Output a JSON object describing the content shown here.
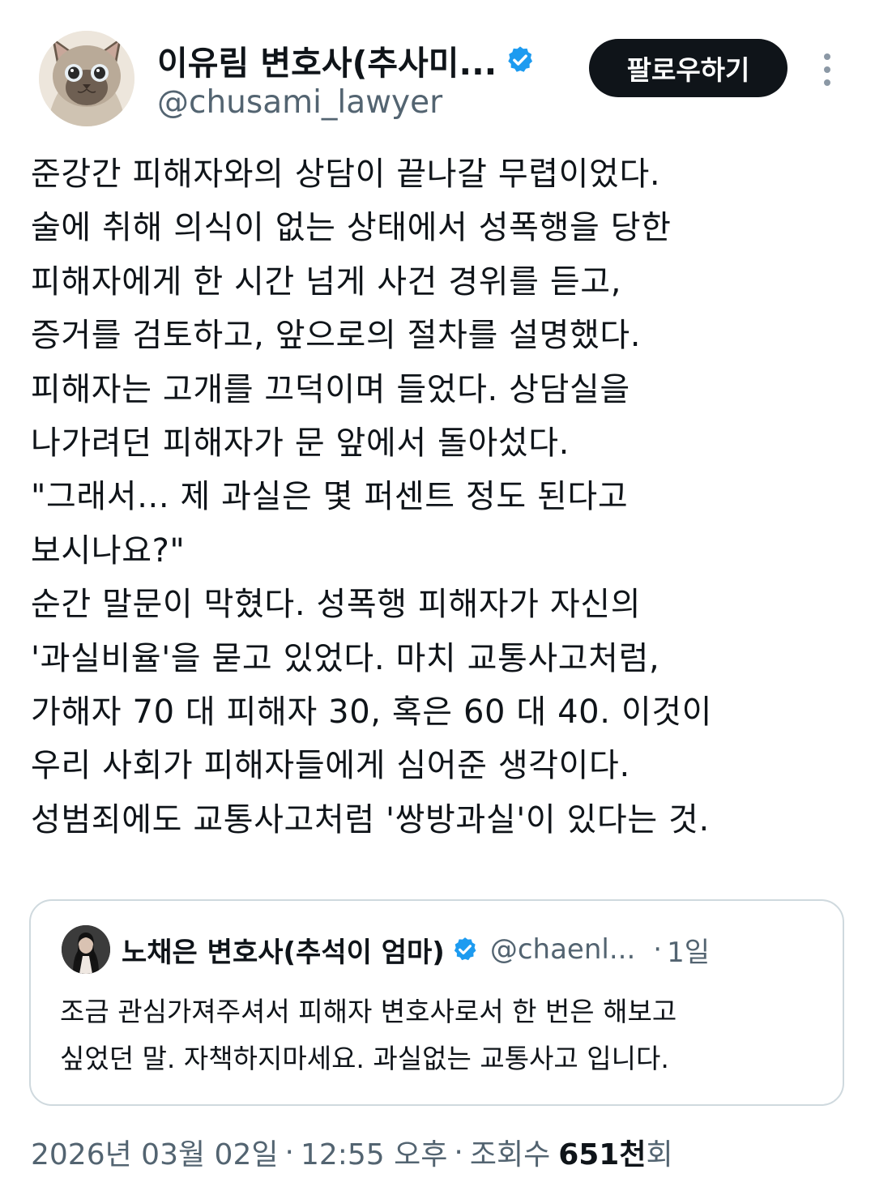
{
  "author": {
    "display_name": "이유림 변호사(추사미...",
    "handle": "@chusami_lawyer",
    "avatar_icon": "cat-avatar-icon",
    "verified_icon": "verified-badge-icon"
  },
  "actions": {
    "follow_label": "팔로우하기",
    "more_icon": "more-options-icon"
  },
  "tweet": {
    "lines": [
      "준강간 피해자와의 상담이 끝나갈 무렵이었다.",
      "술에 취해 의식이 없는 상태에서 성폭행을 당한",
      "피해자에게 한 시간 넘게 사건 경위를 듣고,",
      "증거를 검토하고, 앞으로의 절차를 설명했다.",
      "피해자는 고개를 끄덕이며 들었다. 상담실을",
      "나가려던 피해자가 문 앞에서 돌아섰다.",
      "\"그래서... 제 과실은 몇 퍼센트 정도 된다고",
      "보시나요?\"",
      "순간 말문이 막혔다. 성폭행 피해자가 자신의",
      "'과실비율'을 묻고 있었다. 마치 교통사고처럼,",
      "가해자 70 대 피해자 30, 혹은 60 대 40. 이것이",
      "우리 사회가 피해자들에게 심어준 생각이다.",
      "성범죄에도 교통사고처럼 '쌍방과실'이 있다는 것."
    ]
  },
  "quote": {
    "display_name": "노채은 변호사(추석이 엄마)",
    "handle": "@chaenl...",
    "separator": "·",
    "time": "1일",
    "avatar_icon": "woman-avatar-icon",
    "verified_icon": "verified-badge-icon",
    "lines": [
      "조금 관심가져주셔서 피해자 변호사로서 한 번은 해보고",
      "싶었던 말. 자책하지마세요. 과실없는 교통사고 입니다."
    ]
  },
  "footer": {
    "date": "2026년 03월 02일",
    "separator": "·",
    "time": "12:55 오후",
    "views_label": "조회수",
    "views_count": "651천",
    "views_suffix": "회"
  },
  "colors": {
    "text": "#0f1419",
    "secondary": "#536471",
    "verified": "#1d9bf0",
    "button_bg": "#0f1419",
    "border": "#cfd9de"
  }
}
